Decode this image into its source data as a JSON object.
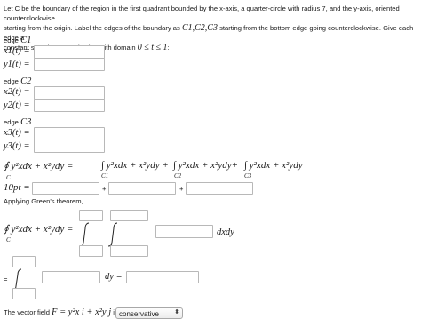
{
  "problem": {
    "text_1": "Let C be the boundary of the region in the first quadrant bounded by the x-axis, a quarter-circle with radius 7, and the y-axis, oriented counterclockwise",
    "text_2a": "starting from the origin. Label the edges of the boundary as ",
    "text_2_math": "C1,C2,C3",
    "text_2b": " starting from the bottom edge going counterclockwise. Give each edge a",
    "text_3a": "constant speed parametrization with domain ",
    "text_3_math": "0 ≤ t ≤ 1",
    "text_3b": ":"
  },
  "edges": [
    {
      "heading": "edge",
      "name": "C1",
      "x_label": "x1(t) =",
      "y_label": "y1(t) =",
      "x_value": "",
      "y_value": ""
    },
    {
      "heading": "edge",
      "name": "C2",
      "x_label": "x2(t) =",
      "y_label": "y2(t) =",
      "x_value": "",
      "y_value": ""
    },
    {
      "heading": "edge",
      "name": "C3",
      "x_label": "x3(t) =",
      "y_label": "y3(t) =",
      "x_value": "",
      "y_value": ""
    }
  ],
  "line_integral": {
    "lhs": "∮ y²xdx + x²ydy =",
    "term1": "∫ y²xdx + x²ydy +",
    "term2": "∫ y²xdx + x²ydy+",
    "term3": "∫ y²xdx + x²ydy",
    "sub_c": "C",
    "sub_c1": "C1",
    "sub_c2": "C2",
    "sub_c3": "C3"
  },
  "sum_row": {
    "lhs": "10pt =",
    "plus": "+",
    "values": [
      "",
      "",
      ""
    ]
  },
  "greens": {
    "label": "Applying Green's theorem,",
    "lhs": "∮ y²xdx + x²ydy =",
    "sub_c": "C",
    "integrand_value": "",
    "differential": "dxdy"
  },
  "single_integral": {
    "eq": "=",
    "differential": "dy ="
  },
  "vector_field": {
    "text_a": "The vector field ",
    "math": "F = y²x i + x²y j",
    "text_b": " is:",
    "selected": "conservative",
    "arrow": "⬍"
  }
}
